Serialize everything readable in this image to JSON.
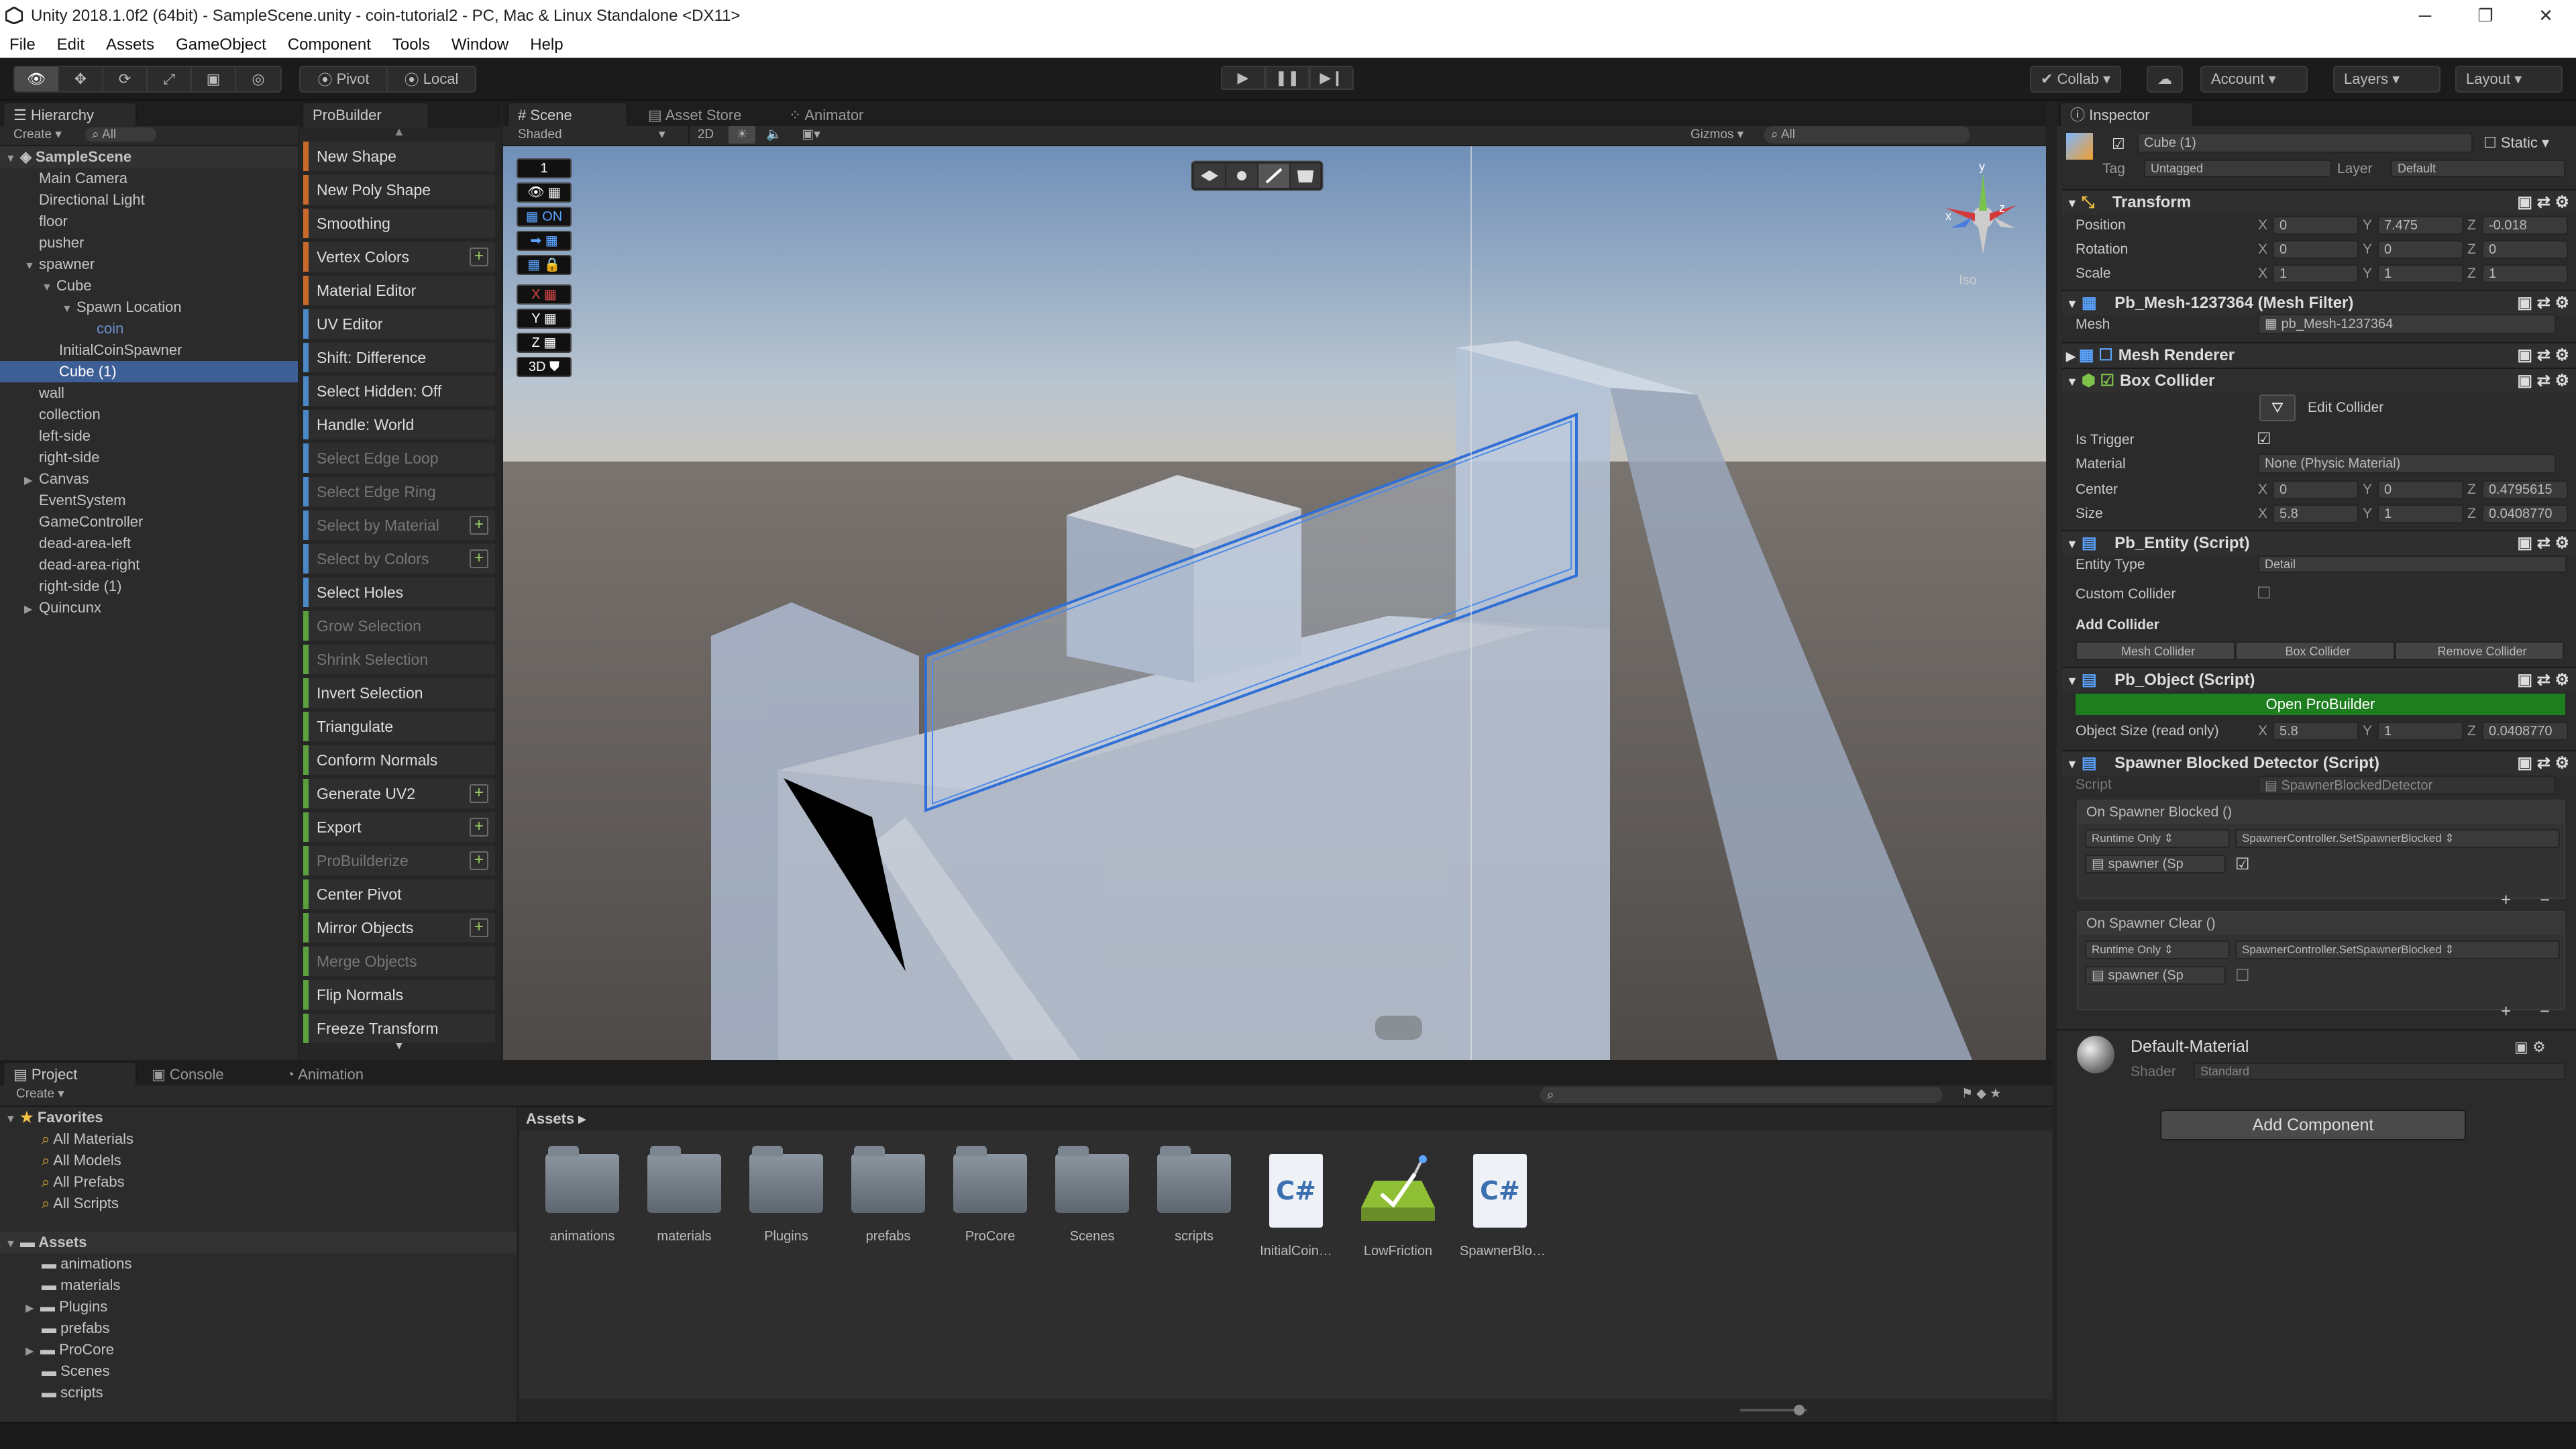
{
  "window": {
    "title": "Unity 2018.1.0f2 (64bit) - SampleScene.unity - coin-tutorial2 - PC, Mac & Linux Standalone <DX11>"
  },
  "menu": [
    "File",
    "Edit",
    "Assets",
    "GameObject",
    "Component",
    "Tools",
    "Window",
    "Help"
  ],
  "toolbar": {
    "pivot": "Pivot",
    "local": "Local",
    "collab": "Collab",
    "account": "Account",
    "layers": "Layers",
    "layout": "Layout"
  },
  "hierarchy": {
    "tab": "Hierarchy",
    "create": "Create",
    "search": "All",
    "scene": "SampleScene",
    "items": [
      {
        "label": "Main Camera",
        "indent": 1
      },
      {
        "label": "Directional Light",
        "indent": 1
      },
      {
        "label": "floor",
        "indent": 1
      },
      {
        "label": "pusher",
        "indent": 1
      },
      {
        "label": "spawner",
        "indent": 1
      },
      {
        "label": "Cube",
        "indent": 2
      },
      {
        "label": "Spawn Location",
        "indent": 3
      },
      {
        "label": "coin",
        "indent": 4
      },
      {
        "label": "InitialCoinSpawner",
        "indent": 3
      },
      {
        "label": "Cube (1)",
        "indent": 3
      },
      {
        "label": "wall",
        "indent": 1
      },
      {
        "label": "collection",
        "indent": 1
      },
      {
        "label": "left-side",
        "indent": 1
      },
      {
        "label": "right-side",
        "indent": 1
      },
      {
        "label": "Canvas",
        "indent": 1
      },
      {
        "label": "EventSystem",
        "indent": 1
      },
      {
        "label": "GameController",
        "indent": 1
      },
      {
        "label": "dead-area-left",
        "indent": 1
      },
      {
        "label": "dead-area-right",
        "indent": 1
      },
      {
        "label": "right-side (1)",
        "indent": 1
      },
      {
        "label": "Quincunx",
        "indent": 1
      }
    ]
  },
  "probuilder": {
    "tab": "ProBuilder",
    "buttons": [
      "New Shape",
      "New Poly Shape",
      "Smoothing",
      "Vertex Colors",
      "Material Editor",
      "UV Editor",
      "Shift: Difference",
      "Select Hidden: Off",
      "Handle: World",
      "Select Edge Loop",
      "Select Edge Ring",
      "Select by Material",
      "Select by Colors",
      "Select Holes",
      "Grow Selection",
      "Shrink Selection",
      "Invert Selection",
      "Triangulate",
      "Conform Normals",
      "Generate UV2",
      "Export",
      "ProBuilderize",
      "Center Pivot",
      "Mirror Objects",
      "Merge Objects",
      "Flip Normals",
      "Freeze Transform"
    ]
  },
  "scene": {
    "tabs": [
      "Scene",
      "Asset Store",
      "Animator"
    ],
    "shading": "Shaded",
    "mode2d": "2D",
    "gizmos": "Gizmos",
    "search": "All",
    "iso": "Iso",
    "overlay": {
      "count": "1",
      "on": "ON",
      "x": "X",
      "y": "Y",
      "z": "Z",
      "three_d": "3D"
    },
    "axes": {
      "x": "x",
      "y": "y",
      "z": "z"
    }
  },
  "inspector": {
    "tab": "Inspector",
    "object_name": "Cube (1)",
    "static": "Static",
    "tag_label": "Tag",
    "tag": "Untagged",
    "layer_label": "Layer",
    "layer": "Default",
    "transform": {
      "title": "Transform",
      "position_label": "Position",
      "rotation_label": "Rotation",
      "scale_label": "Scale",
      "position": [
        "0",
        "7.475",
        "-0.018"
      ],
      "rotation": [
        "0",
        "0",
        "0"
      ],
      "scale": [
        "1",
        "1",
        "1"
      ]
    },
    "axis_x": "X",
    "axis_y": "Y",
    "axis_z": "Z",
    "mesh_filter": {
      "title": "Pb_Mesh-1237364 (Mesh Filter)",
      "mesh_label": "Mesh",
      "mesh": "pb_Mesh-1237364"
    },
    "mesh_renderer": {
      "title": "Mesh Renderer"
    },
    "box_collider": {
      "title": "Box Collider",
      "edit": "Edit Collider",
      "is_trigger": "Is Trigger",
      "material_label": "Material",
      "material": "None (Physic Material)",
      "center_label": "Center",
      "center": [
        "0",
        "0",
        "0.4795615"
      ],
      "size_label": "Size",
      "size": [
        "5.8",
        "1",
        "0.0408770"
      ]
    },
    "pb_entity": {
      "title": "Pb_Entity (Script)",
      "entity_type_label": "Entity Type",
      "entity_type": "Detail",
      "custom_collider": "Custom Collider",
      "add_collider": "Add Collider",
      "buttons": [
        "Mesh Collider",
        "Box Collider",
        "Remove Collider"
      ]
    },
    "pb_object": {
      "title": "Pb_Object (Script)",
      "open": "Open ProBuilder",
      "object_size_label": "Object Size (read only)",
      "object_size": [
        "5.8",
        "1",
        "0.0408770"
      ]
    },
    "spawner": {
      "title": "Spawner Blocked Detector (Script)",
      "script_label": "Script",
      "script": "SpawnerBlockedDetector",
      "blocked": "On Spawner Blocked ()",
      "clear": "On Spawner Clear ()",
      "runtime": "Runtime Only",
      "method": "SpawnerController.SetSpawnerBlocked",
      "target": "spawner (Sp"
    },
    "material": {
      "name": "Default-Material",
      "shader_label": "Shader",
      "shader": "Standard"
    },
    "add_component": "Add Component"
  },
  "project": {
    "tabs": [
      "Project",
      "Console",
      "Animation"
    ],
    "create": "Create",
    "favorites_title": "Favorites",
    "favorites": [
      "All Materials",
      "All Models",
      "All Prefabs",
      "All Scripts"
    ],
    "assets_title": "Assets",
    "tree": [
      "animations",
      "materials",
      "Plugins",
      "prefabs",
      "ProCore",
      "Scenes",
      "scripts"
    ],
    "breadcrumb": "Assets",
    "files": [
      {
        "label": "animations",
        "kind": "folder"
      },
      {
        "label": "materials",
        "kind": "folder"
      },
      {
        "label": "Plugins",
        "kind": "folder"
      },
      {
        "label": "prefabs",
        "kind": "folder"
      },
      {
        "label": "ProCore",
        "kind": "folder"
      },
      {
        "label": "Scenes",
        "kind": "folder"
      },
      {
        "label": "scripts",
        "kind": "folder"
      },
      {
        "label": "InitialCoin…",
        "kind": "cs"
      },
      {
        "label": "LowFriction",
        "kind": "material"
      },
      {
        "label": "SpawnerBlo…",
        "kind": "cs"
      }
    ],
    "cs_glyph": "C#"
  },
  "colors": {
    "selection": "#3e5f96",
    "probuilder_orange": "#c9692c",
    "probuilder_blue": "#4a88c6",
    "probuilder_green": "#5c9f3f",
    "open_probuilder": "#1e7d1e"
  }
}
